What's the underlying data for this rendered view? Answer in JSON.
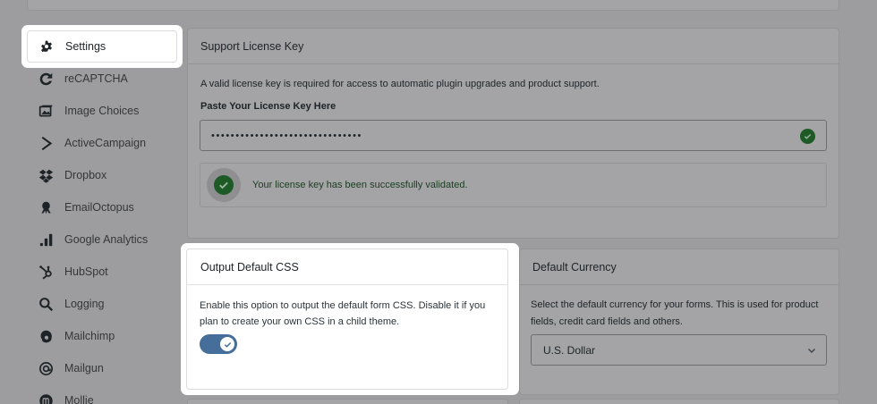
{
  "sidebar": {
    "items": [
      {
        "label": "Settings",
        "icon": "gear-icon"
      },
      {
        "label": "reCAPTCHA",
        "icon": "recaptcha-icon"
      },
      {
        "label": "Image Choices",
        "icon": "image-choices-icon"
      },
      {
        "label": "ActiveCampaign",
        "icon": "activecampaign-icon"
      },
      {
        "label": "Dropbox",
        "icon": "dropbox-icon"
      },
      {
        "label": "EmailOctopus",
        "icon": "emailoctopus-icon"
      },
      {
        "label": "Google Analytics",
        "icon": "google-analytics-icon"
      },
      {
        "label": "HubSpot",
        "icon": "hubspot-icon"
      },
      {
        "label": "Logging",
        "icon": "search-icon"
      },
      {
        "label": "Mailchimp",
        "icon": "mailchimp-icon"
      },
      {
        "label": "Mailgun",
        "icon": "mailgun-icon"
      },
      {
        "label": "Mollie",
        "icon": "mollie-icon"
      }
    ]
  },
  "license": {
    "title": "Support License Key",
    "description": "A valid license key is required for access to automatic plugin upgrades and product support.",
    "field_label": "Paste Your License Key Here",
    "field_value": "•••••••••••••••••••••••••••••••",
    "validation_message": "Your license key has been successfully validated."
  },
  "output_css": {
    "title": "Output Default CSS",
    "description": "Enable this option to output the default form CSS. Disable it if you plan to create your own CSS in a child theme.",
    "enabled": true
  },
  "currency": {
    "title": "Default Currency",
    "description": "Select the default currency for your forms. This is used for product fields, credit card fields and others.",
    "selected": "U.S. Dollar"
  },
  "colors": {
    "overlay": "#9d9d9f",
    "toggle_on": "#456e9a",
    "success": "#1e5a26"
  }
}
